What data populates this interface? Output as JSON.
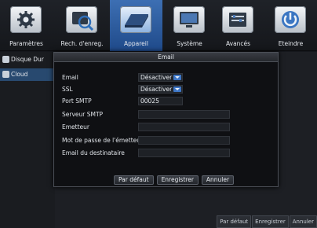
{
  "nav": {
    "items": [
      {
        "label": "Paramètres",
        "icon": "gear-icon"
      },
      {
        "label": "Rech. d'enreg.",
        "icon": "search-icon"
      },
      {
        "label": "Appareil",
        "icon": "hard-drive-icon"
      },
      {
        "label": "Système",
        "icon": "monitor-icon"
      },
      {
        "label": "Avancés",
        "icon": "settings-panel-icon"
      },
      {
        "label": "Eteindre",
        "icon": "power-icon"
      }
    ],
    "active_index": 2
  },
  "sidebar": {
    "items": [
      {
        "label": "Disque Dur",
        "icon": "disk-icon"
      },
      {
        "label": "Cloud",
        "icon": "cloud-icon"
      }
    ],
    "active_index": 1
  },
  "bottom_buttons": {
    "default_label": "Par défaut",
    "save_label": "Enregistrer",
    "cancel_label": "Annuler"
  },
  "dialog": {
    "title": "Email",
    "fields": {
      "email": {
        "label": "Email",
        "value": "Désactiver"
      },
      "ssl": {
        "label": "SSL",
        "value": "Désactiver"
      },
      "smtp_port": {
        "label": "Port SMTP",
        "value": "00025"
      },
      "smtp_server": {
        "label": "Serveur SMTP",
        "value": ""
      },
      "sender": {
        "label": "Emetteur",
        "value": ""
      },
      "sender_password": {
        "label": "Mot de passe de l'émetteur",
        "value": ""
      },
      "recipient_email": {
        "label": "Email du destinataire",
        "value": ""
      }
    },
    "buttons": {
      "default_label": "Par défaut",
      "save_label": "Enregistrer",
      "cancel_label": "Annuler"
    }
  },
  "colors": {
    "accent": "#3e76c5",
    "active_tab": "#2f5f9f",
    "background": "#15171c"
  }
}
